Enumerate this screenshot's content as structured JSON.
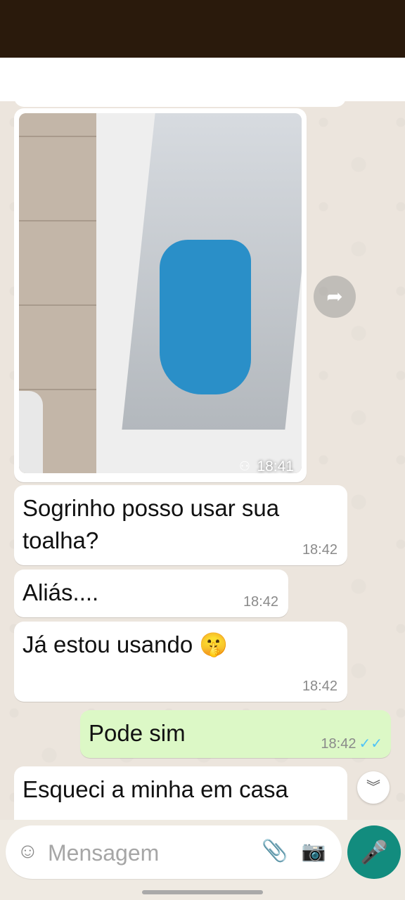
{
  "messages": [
    {
      "type": "image",
      "time": "18:41"
    },
    {
      "type": "in",
      "text": "Sogrinho posso usar sua toalha?",
      "time": "18:42"
    },
    {
      "type": "in",
      "text": "Aliás....",
      "time": "18:42"
    },
    {
      "type": "in",
      "text": "Já estou usando 🤫",
      "time": "18:42"
    },
    {
      "type": "out",
      "text": "Pode sim",
      "time": "18:42",
      "status": "read"
    },
    {
      "type": "in",
      "text": "Esqueci a minha em casa"
    }
  ],
  "input": {
    "placeholder": "Mensagem",
    "value": ""
  },
  "icons": {
    "forward": "forward-icon",
    "scroll_down": "double-chevron-down-icon",
    "emoji": "emoji-icon",
    "attach": "paperclip-icon",
    "camera": "camera-icon",
    "mic": "microphone-icon",
    "read_receipt": "double-check-icon"
  },
  "colors": {
    "header": "#2a1a0c",
    "chat_bg": "#ece5dd",
    "out_bubble": "#dcf8c6",
    "mic_button": "#128c7e",
    "read_check": "#4fc3f7"
  }
}
